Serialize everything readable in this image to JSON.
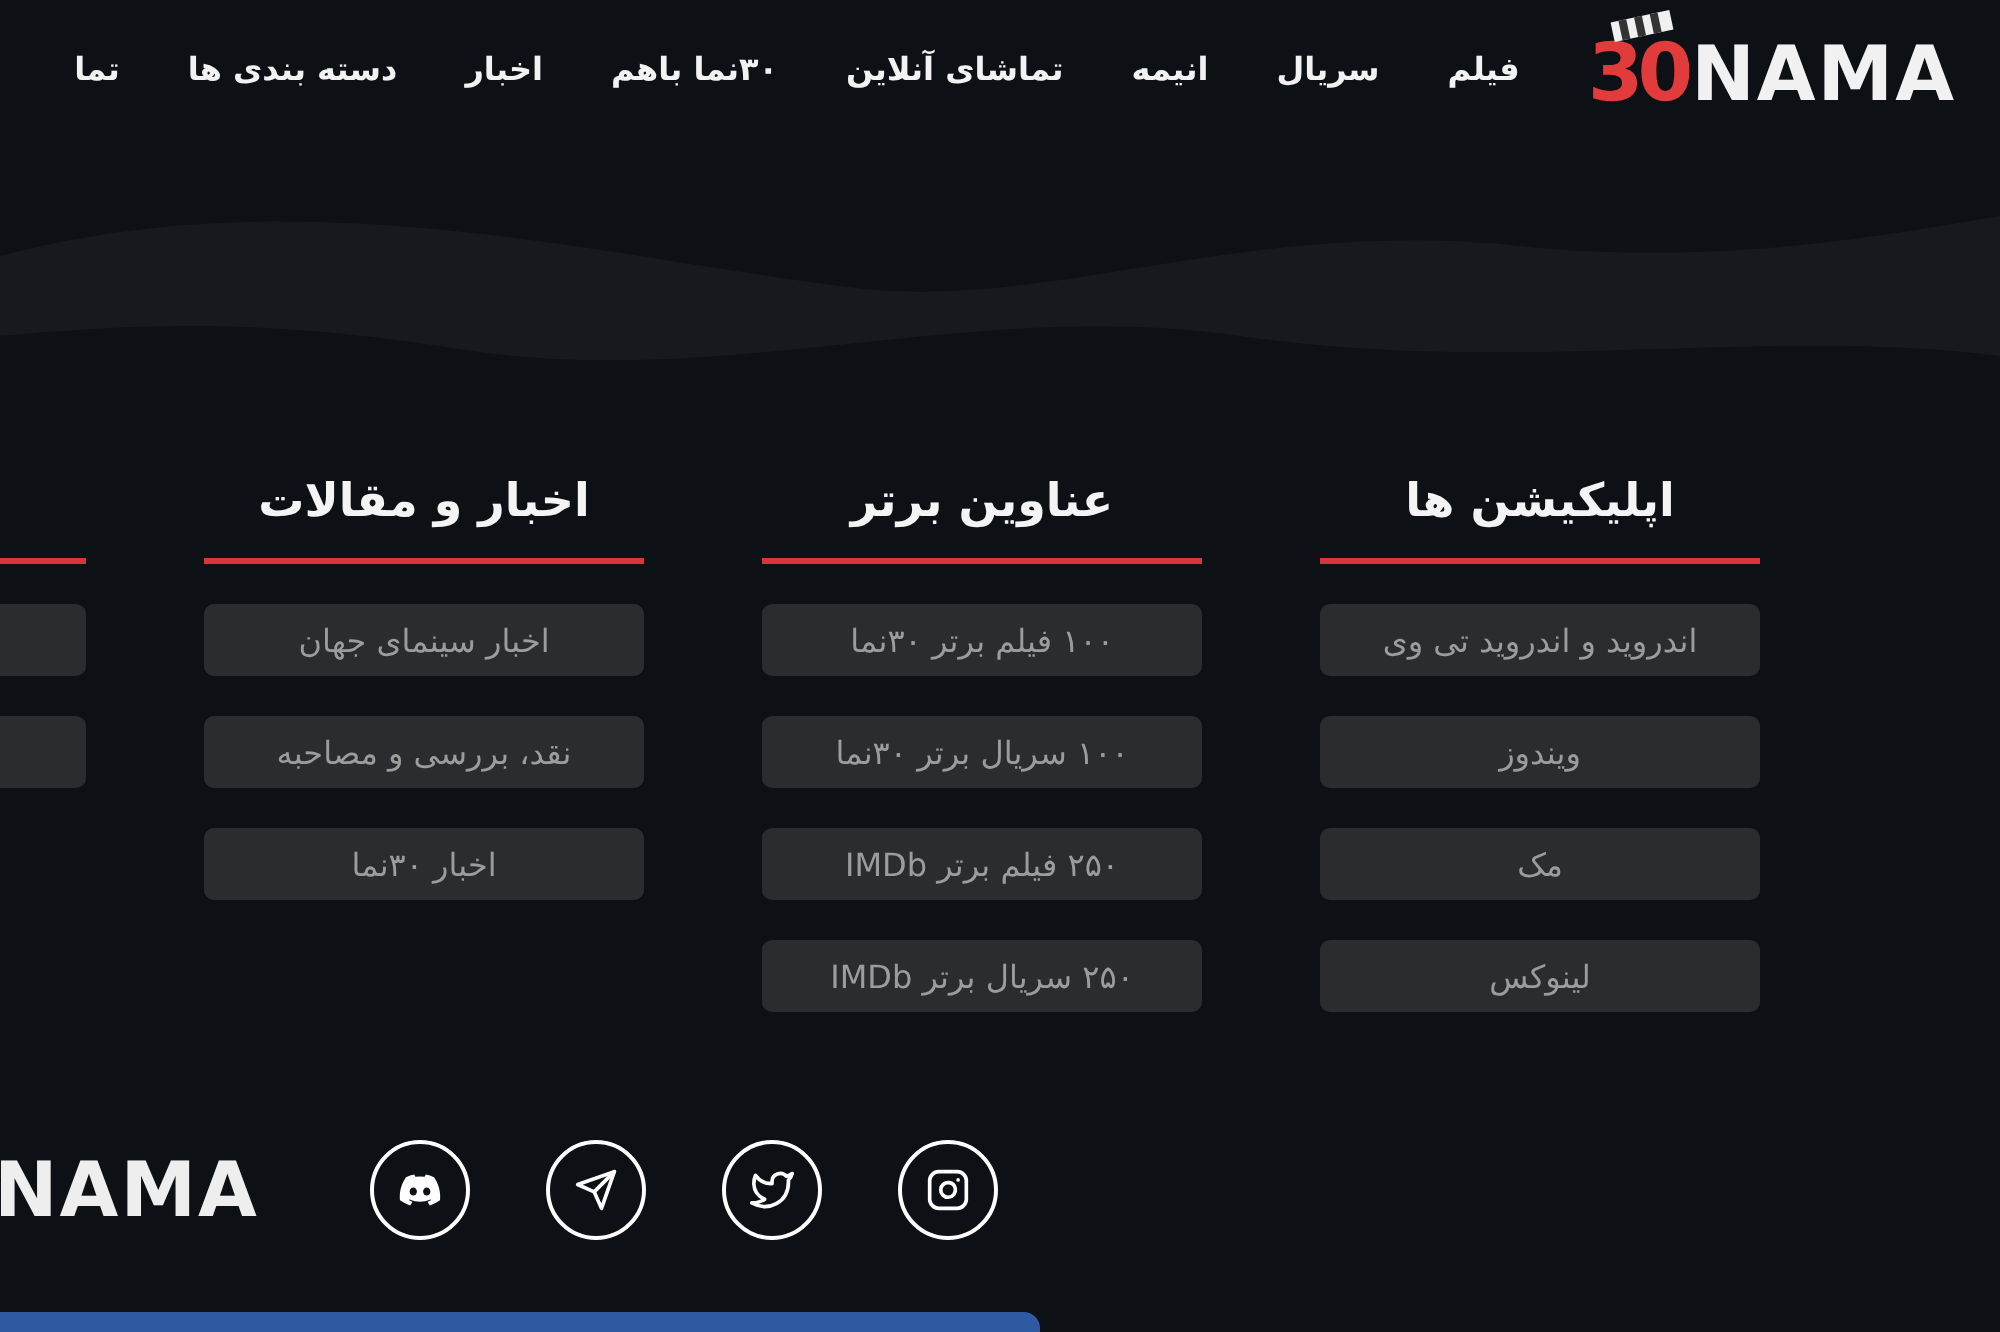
{
  "header": {
    "logo": {
      "mark": "30",
      "name": "NAMA"
    },
    "nav": [
      "فیلم",
      "سریال",
      "انیمه",
      "تماشای آنلاین",
      "۳۰نما باهم",
      "اخبار",
      "دسته بندی ها",
      "تما"
    ]
  },
  "columns": [
    {
      "title": "اپلیکیشن ها",
      "links": [
        "اندروید و اندروید تی وی",
        "ویندوز",
        "مک",
        "لینوکس"
      ]
    },
    {
      "title": "عناوین برتر",
      "links": [
        "۱۰۰ فیلم برتر ۳۰نما",
        "۱۰۰ سریال برتر ۳۰نما",
        "۲۵۰ فیلم برتر IMDb",
        "۲۵۰ سریال برتر IMDb"
      ]
    },
    {
      "title": "اخبار و مقالات",
      "links": [
        "اخبار سینمای جهان",
        "نقد، بررسی و مصاحبه",
        "اخبار ۳۰نما"
      ]
    }
  ],
  "footer": {
    "logo_name": "NAMA",
    "social": [
      {
        "kind": "instagram"
      },
      {
        "kind": "twitter"
      },
      {
        "kind": "telegram"
      },
      {
        "kind": "discord"
      }
    ]
  }
}
